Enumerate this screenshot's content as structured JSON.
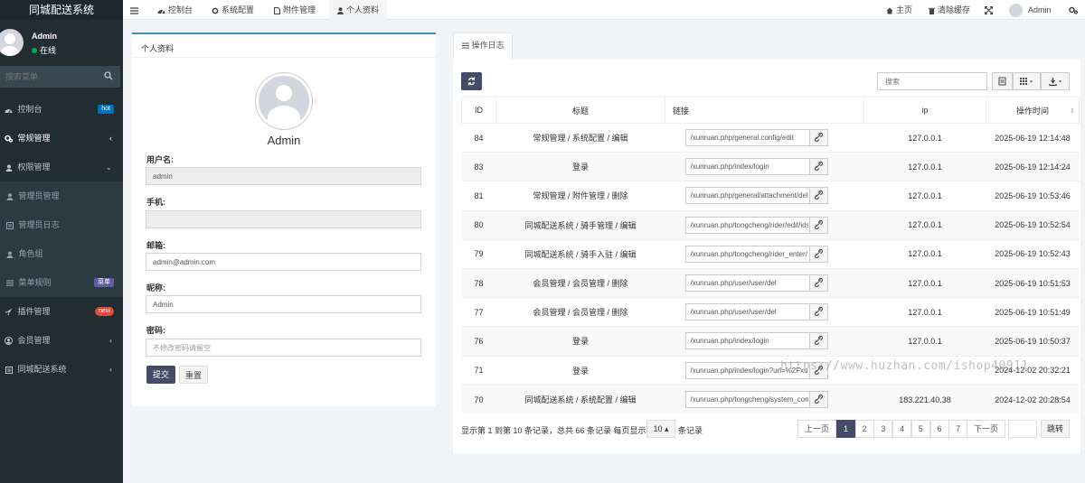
{
  "app_title": "同城配送系统",
  "user": {
    "name": "Admin",
    "status": "在线"
  },
  "sidebar": {
    "search_placeholder": "搜索菜单",
    "items": [
      {
        "label": "控制台",
        "icon": "dashboard-icon",
        "badge": "hot",
        "badge_color": "#0073b7"
      },
      {
        "label": "常规管理",
        "icon": "cogs-icon",
        "active": true
      },
      {
        "label": "权限管理",
        "icon": "group-icon"
      },
      {
        "label": "管理员管理",
        "icon": "user-icon",
        "sub": true
      },
      {
        "label": "管理员日志",
        "icon": "list-icon",
        "sub": true
      },
      {
        "label": "角色组",
        "icon": "group-icon",
        "sub": true
      },
      {
        "label": "菜单规则",
        "icon": "bars-icon",
        "badge": "菜单",
        "badge_color": "#605ca8",
        "sub": true
      },
      {
        "label": "插件管理",
        "icon": "rocket-icon",
        "badge": "new",
        "badge_color": "#dd4b39"
      },
      {
        "label": "会员管理",
        "icon": "user-circle-icon"
      },
      {
        "label": "同城配送系统",
        "icon": "list-alt-icon"
      }
    ]
  },
  "topnav": {
    "tabs": [
      {
        "label": "控制台",
        "icon": "dashboard-icon"
      },
      {
        "label": "系统配置",
        "icon": "cog-icon"
      },
      {
        "label": "附件管理",
        "icon": "file-icon"
      },
      {
        "label": "个人资料",
        "icon": "user-icon",
        "active": true
      }
    ],
    "right": {
      "home_label": "主页",
      "clear_cache_label": "清除缓存",
      "user_name": "Admin"
    }
  },
  "profile": {
    "panel_title": "个人资料",
    "display_name": "Admin",
    "fields": {
      "username_label": "用户名:",
      "username_value": "admin",
      "mobile_label": "手机:",
      "mobile_value": "",
      "email_label": "邮箱:",
      "email_value": "admin@admin.com",
      "nickname_label": "昵称:",
      "nickname_value": "Admin",
      "password_label": "密码:",
      "password_placeholder": "不修改密码请留空"
    },
    "submit_label": "提交",
    "reset_label": "重置"
  },
  "log": {
    "tab_label": "操作日志",
    "search_placeholder": "搜索",
    "columns": [
      "ID",
      "标题",
      "链接",
      "ip",
      "操作时间"
    ],
    "rows": [
      {
        "id": "84",
        "title": "常规管理 / 系统配置 / 编辑",
        "url": "/xunruan.php/general.config/edit",
        "ip": "127.0.0.1",
        "time": "2025-06-19 12:14:48"
      },
      {
        "id": "83",
        "title": "登录",
        "url": "/xunruan.php/index/login",
        "ip": "127.0.0.1",
        "time": "2025-06-19 12:14:24"
      },
      {
        "id": "81",
        "title": "常规管理 / 附件管理 / 删除",
        "url": "/xunruan.php/general/attachment/del",
        "ip": "127.0.0.1",
        "time": "2025-06-19 10:53:46"
      },
      {
        "id": "80",
        "title": "同城配送系统 / 骑手管理 / 编辑",
        "url": "/xunruan.php/tongcheng/rider/edit/ids",
        "ip": "127.0.0.1",
        "time": "2025-06-19 10:52:54"
      },
      {
        "id": "79",
        "title": "同城配送系统 / 骑手入驻 / 编辑",
        "url": "/xunruan.php/tongcheng/rider_enter/",
        "ip": "127.0.0.1",
        "time": "2025-06-19 10:52:43"
      },
      {
        "id": "78",
        "title": "会员管理 / 会员管理 / 删除",
        "url": "/xunruan.php/user/user/del",
        "ip": "127.0.0.1",
        "time": "2025-06-19 10:51:53"
      },
      {
        "id": "77",
        "title": "会员管理 / 会员管理 / 删除",
        "url": "/xunruan.php/user/user/del",
        "ip": "127.0.0.1",
        "time": "2025-06-19 10:51:49"
      },
      {
        "id": "76",
        "title": "登录",
        "url": "/xunruan.php/index/login",
        "ip": "127.0.0.1",
        "time": "2025-06-19 10:50:37"
      },
      {
        "id": "71",
        "title": "登录",
        "url": "/xunruan.php/index/login?url=%2Fxun",
        "ip": "",
        "time": "2024-12-02 20:32:21"
      },
      {
        "id": "70",
        "title": "同城配送系统 / 系统配置 / 编辑",
        "url": "/xunruan.php/tongcheng/system_con",
        "ip": "183.221.40.38",
        "time": "2024-12-02 20:28:54"
      }
    ],
    "footer": {
      "info": "显示第 1 到第 10 条记录，总共 66 条记录 每页显示",
      "page_size": "10",
      "page_size_tail": "条记录"
    },
    "pagination": {
      "prev": "上一页",
      "pages": [
        "1",
        "2",
        "3",
        "4",
        "5",
        "6",
        "7"
      ],
      "current": "1",
      "next": "下一页",
      "jump": "跳转"
    }
  },
  "watermark": "https://www.huzhan.com/ishop40911"
}
